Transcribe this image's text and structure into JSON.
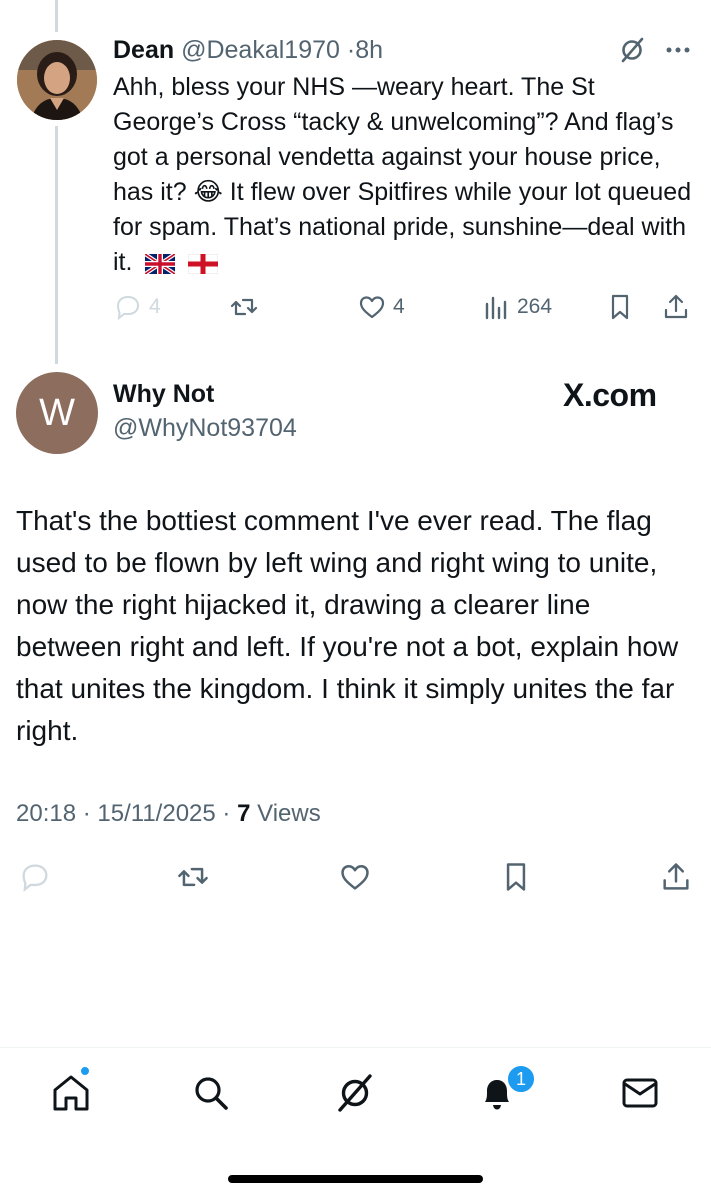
{
  "reply_tweet": {
    "author_name": "Dean",
    "author_handle": "@Deakal1970",
    "separator": "·",
    "time_ago": "8h",
    "text": "Ahh, bless your NHS —weary heart. The St George’s Cross “tacky & unwelcoming”? And flag’s got a personal vendetta against your house price, has it? 😂 It flew over Spitfires while your lot queued for spam. That’s national pride, sunshine—deal with it.",
    "stats": {
      "replies": "4",
      "likes": "4",
      "views": "264"
    }
  },
  "main_tweet": {
    "avatar_letter": "W",
    "avatar_color": "#8c6d5e",
    "author_name": "Why Not",
    "author_handle": "@WhyNot93704",
    "watermark": "X.com",
    "text": "That's the bottiest comment I've ever read. The flag used to be flown by left wing and right wing to unite, now the right hijacked it, drawing a clearer line between right and left. If you're not a bot, explain how that unites the kingdom. I think it simply unites the far right.",
    "time": "20:18",
    "date": "15/11/2025",
    "views_count": "7",
    "views_label": "Views"
  },
  "tab_bar": {
    "notifications_badge": "1",
    "accent_color": "#1d9bf0"
  },
  "icons": [
    "grok-icon",
    "more-icon",
    "reply-icon",
    "retweet-icon",
    "like-icon",
    "views-icon",
    "bookmark-icon",
    "share-icon",
    "home-icon",
    "search-icon",
    "bell-icon",
    "mail-icon"
  ]
}
